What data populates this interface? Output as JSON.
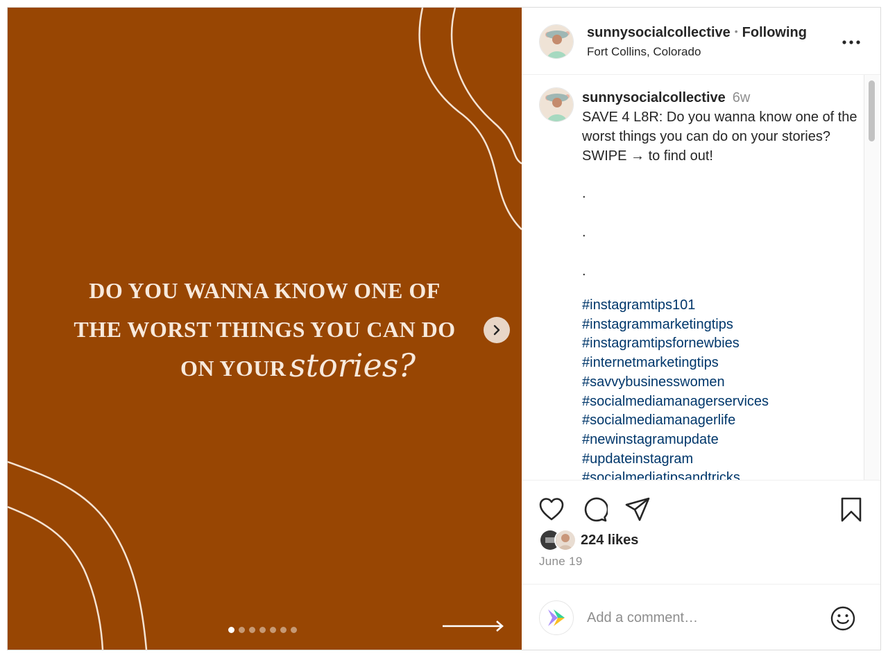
{
  "post": {
    "username": "sunnysocialcollective",
    "separator": "•",
    "follow_status": "Following",
    "location": "Fort Collins, Colorado"
  },
  "media": {
    "background_color": "#984603",
    "headline_lines": [
      "DO YOU WANNA KNOW ONE OF",
      "THE WORST THINGS YOU CAN DO",
      "ON YOUR"
    ],
    "script_word": "stories?",
    "slide_count": 7,
    "active_slide": 1
  },
  "caption": {
    "username": "sunnysocialcollective",
    "time_ago": "6w",
    "text": "SAVE 4 L8R: Do you wanna know one of the worst things you can do on your stories? SWIPE → to find out!",
    "dots": [
      ".",
      ".",
      "."
    ],
    "hashtags": [
      "#instagramtips101",
      "#instagrammarketingtips",
      "#instagramtipsfornewbies",
      "#internetmarketingtips",
      "#savvybusinesswomen",
      "#socialmediamanagerservices",
      "#socialmediamanagerlife",
      "#newinstagramupdate",
      "#updateinstagram",
      "#socialmediatipsandtricks"
    ]
  },
  "actions": {
    "icons": [
      "heart-icon",
      "comment-icon",
      "share-icon",
      "bookmark-icon"
    ],
    "likes_text": "224 likes",
    "date": "June 19"
  },
  "comment_box": {
    "placeholder": "Add a comment…",
    "emoji_icon": "smiley-icon"
  },
  "colors": {
    "hashtag": "#00376b",
    "muted": "#8e8e8e",
    "media_bg": "#984603"
  }
}
